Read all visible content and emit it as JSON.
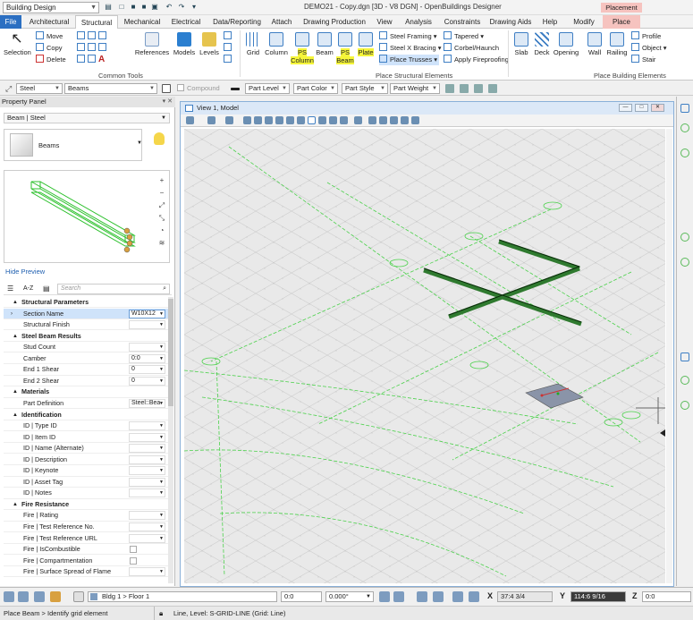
{
  "titlebar": {
    "workflow": "Building Design",
    "document_title": "DEMO21 - Copy.dgn [3D - V8 DGN] - OpenBuildings Designer",
    "context_tab": "Placement"
  },
  "tabs": [
    "File",
    "Architectural",
    "Structural",
    "Mechanical",
    "Electrical",
    "Data/Reporting",
    "Attach",
    "Drawing Production",
    "View",
    "Analysis",
    "Constraints",
    "Drawing Aids",
    "Help",
    "Modify",
    "Place"
  ],
  "ribbon": {
    "common": {
      "selection": "Selection",
      "move": "Move",
      "copy": "Copy",
      "delete": "Delete",
      "references": "References",
      "models": "Models",
      "levels": "Levels",
      "group": "Common Tools"
    },
    "structural": {
      "grid": "Grid",
      "column": "Column",
      "ps_column": "PS Column",
      "beam": "Beam",
      "ps_beam": "PS Beam",
      "plate": "Plate",
      "steel_framing": "Steel Framing",
      "steel_x_bracing": "Steel X Bracing",
      "place_trusses": "Place Trusses",
      "tapered": "Tapered",
      "corbel_haunch": "Corbel/Haunch",
      "apply_fireproofing": "Apply Fireproofing",
      "group": "Place Structural Elements"
    },
    "building": {
      "slab": "Slab",
      "deck": "Deck",
      "opening": "Opening",
      "wall": "Wall",
      "railing": "Railing",
      "profile": "Profile",
      "object": "Object",
      "stair": "Stair",
      "group": "Place Building Elements"
    }
  },
  "attrbar": {
    "family": "Steel",
    "part": "Beams",
    "compound": "Compound",
    "part_level": "Part Level",
    "part_color": "Part Color",
    "part_style": "Part Style",
    "part_weight": "Part Weight"
  },
  "property_panel": {
    "title": "Property Panel",
    "type": "Beam | Steel",
    "card_label": "Beams",
    "hide_preview": "Hide Preview",
    "sort_label": "A-Z",
    "search_placeholder": "Search",
    "rows": [
      {
        "kind": "section",
        "label": "Structural Parameters"
      },
      {
        "kind": "field",
        "label": "Section Name",
        "value": "W10X12",
        "selected": true
      },
      {
        "kind": "field",
        "label": "Structural Finish",
        "value": ""
      },
      {
        "kind": "section",
        "label": "Steel Beam Results"
      },
      {
        "kind": "field",
        "label": "Stud Count",
        "value": ""
      },
      {
        "kind": "field",
        "label": "Camber",
        "value": "0:0"
      },
      {
        "kind": "field",
        "label": "End 1 Shear",
        "value": "0"
      },
      {
        "kind": "field",
        "label": "End 2 Shear",
        "value": "0"
      },
      {
        "kind": "section",
        "label": "Materials"
      },
      {
        "kind": "field",
        "label": "Part Definition",
        "value": "Steel::Bea"
      },
      {
        "kind": "section",
        "label": "Identification"
      },
      {
        "kind": "field",
        "label": "ID | Type ID",
        "value": ""
      },
      {
        "kind": "field",
        "label": "ID | Item ID",
        "value": ""
      },
      {
        "kind": "field",
        "label": "ID | Name (Alternate)",
        "value": ""
      },
      {
        "kind": "field",
        "label": "ID | Description",
        "value": ""
      },
      {
        "kind": "field",
        "label": "ID | Keynote",
        "value": ""
      },
      {
        "kind": "field",
        "label": "ID | Asset Tag",
        "value": ""
      },
      {
        "kind": "field",
        "label": "ID | Notes",
        "value": ""
      },
      {
        "kind": "section",
        "label": "Fire Resistance"
      },
      {
        "kind": "field",
        "label": "Fire | Rating",
        "value": ""
      },
      {
        "kind": "field",
        "label": "Fire | Test Reference No.",
        "value": ""
      },
      {
        "kind": "field",
        "label": "Fire | Test Reference URL",
        "value": ""
      },
      {
        "kind": "check",
        "label": "Fire | IsCombustible"
      },
      {
        "kind": "check",
        "label": "Fire | Compartmentation"
      },
      {
        "kind": "field",
        "label": "Fire | Surface Spread of Flame",
        "value": ""
      }
    ]
  },
  "view": {
    "title": "View 1, Model"
  },
  "statusbar": {
    "floor": "Bldg 1 > Floor 1",
    "offset": "0:0",
    "angle": "0.000°",
    "x_label": "X",
    "x_value": "37:4 3/4",
    "y_label": "Y",
    "y_value": "114:6 9/16",
    "z_label": "Z",
    "z_value": "0:0",
    "prompt": "Place Beam > Identify grid element",
    "element_info": "Line, Level: S-GRID-LINE (Grid: Line)"
  }
}
